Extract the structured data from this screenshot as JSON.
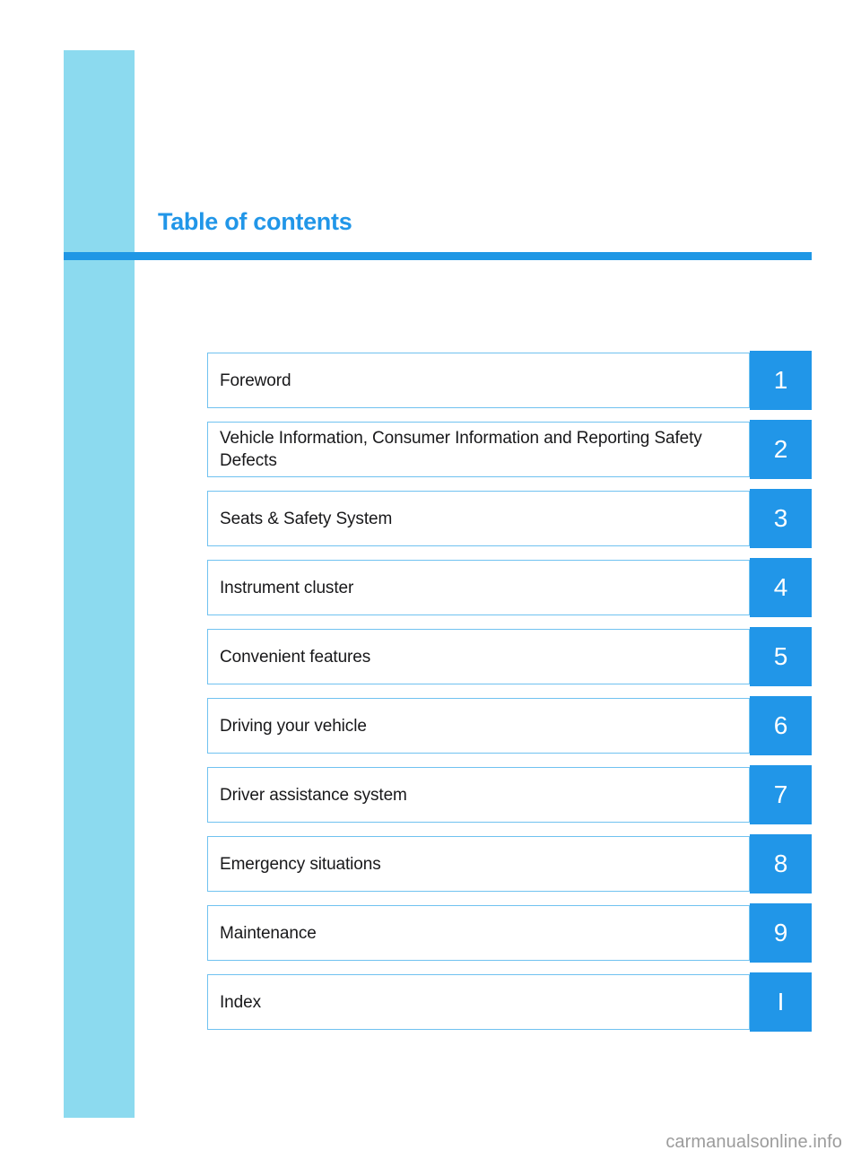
{
  "page": {
    "title": "Table of contents",
    "watermark": "carmanualsonline.info"
  },
  "colors": {
    "accent_blue": "#2196e8",
    "rule_blue": "#1f97e5",
    "band_blue": "#8cdaef",
    "border_blue": "#70c2f0",
    "text_black": "#18181a",
    "watermark_gray": "#9c9c9c"
  },
  "contents": [
    {
      "label": "Foreword",
      "tab": "1",
      "lines": 1
    },
    {
      "label": "Vehicle Information, Consumer Information and Reporting Safety Defects",
      "tab": "2",
      "lines": 2
    },
    {
      "label": "Seats & Safety System",
      "tab": "3",
      "lines": 1
    },
    {
      "label": "Instrument cluster",
      "tab": "4",
      "lines": 1
    },
    {
      "label": "Convenient features",
      "tab": "5",
      "lines": 1
    },
    {
      "label": "Driving your vehicle",
      "tab": "6",
      "lines": 1
    },
    {
      "label": "Driver assistance system",
      "tab": "7",
      "lines": 1
    },
    {
      "label": "Emergency situations",
      "tab": "8",
      "lines": 1
    },
    {
      "label": "Maintenance",
      "tab": "9",
      "lines": 1
    },
    {
      "label": "Index",
      "tab": "I",
      "lines": 1
    }
  ]
}
